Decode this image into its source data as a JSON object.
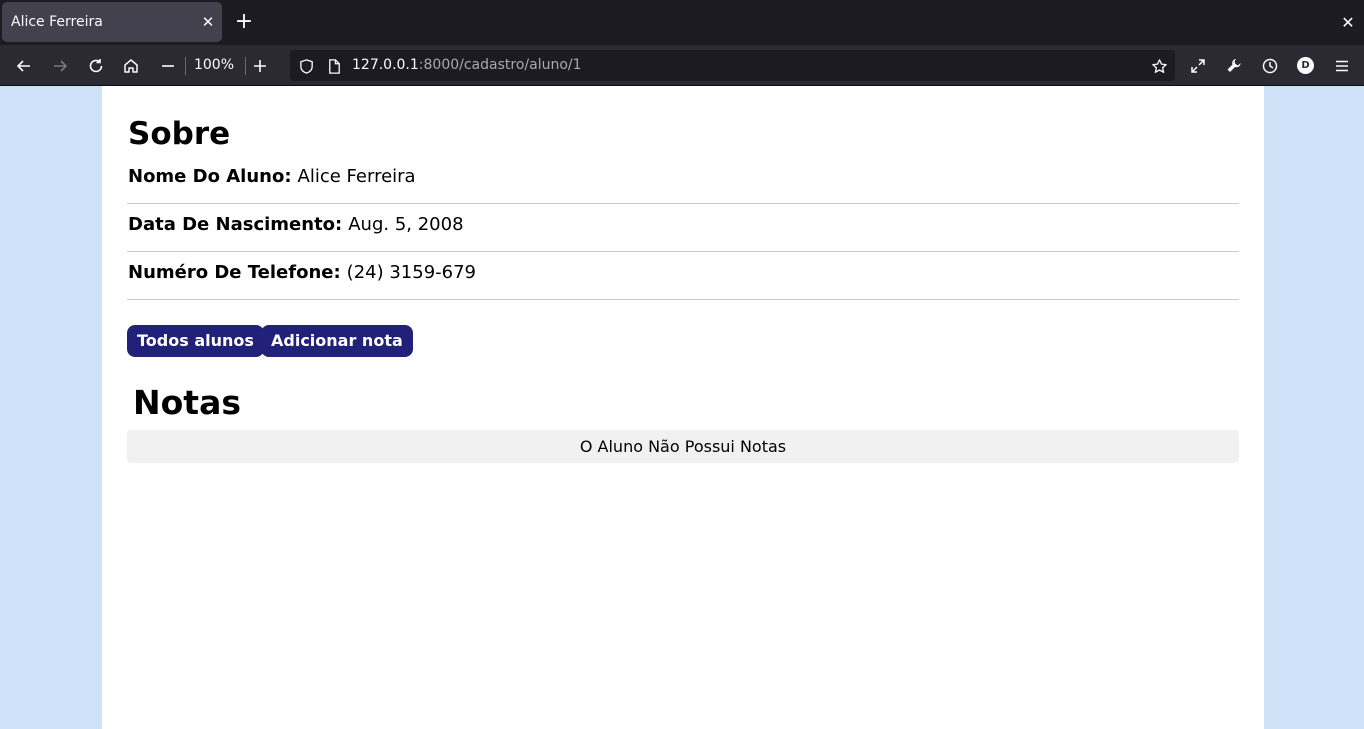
{
  "browser": {
    "tab_title": "Alice Ferreira",
    "tab_close_icon": "close-icon",
    "new_tab_icon": "plus-icon",
    "window_close_icon": "close-icon",
    "zoom_level": "100%",
    "url_host": "127.0.0.1",
    "url_path": ":8000/cadastro/aluno/1"
  },
  "page": {
    "about_heading": "Sobre",
    "fields": [
      {
        "label": "Nome Do Aluno:",
        "value": "Alice Ferreira"
      },
      {
        "label": "Data De Nascimento:",
        "value": "Aug. 5, 2008"
      },
      {
        "label": "Numéro De Telefone:",
        "value": "(24) 3159-679"
      }
    ],
    "buttons": {
      "all_students": "Todos alunos",
      "add_grade": "Adicionar nota"
    },
    "grades_heading": "Notas",
    "grades_empty": "O Aluno Não Possui Notas"
  },
  "colors": {
    "page_background": "#cfe3f8",
    "button_background": "#21217a",
    "empty_box": "#f1f1f1"
  }
}
